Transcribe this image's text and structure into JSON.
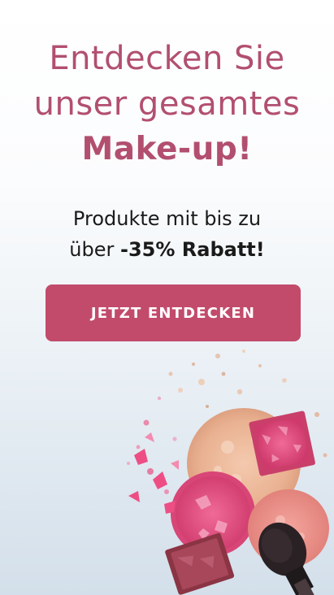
{
  "headline": {
    "line1": "Entdecken Sie",
    "line2": "unser gesamtes",
    "line3": "Make-up!"
  },
  "subline": {
    "line1": "Produkte mit bis zu",
    "prefix": "über",
    "highlight": "-35% Rabatt!"
  },
  "cta": {
    "label": "JETZT ENTDECKEN"
  },
  "colors": {
    "accent": "#b24f6f",
    "button": "#c24b6b",
    "text": "#1a1a1a"
  },
  "image": {
    "icon": "makeup-powder-illustration"
  }
}
